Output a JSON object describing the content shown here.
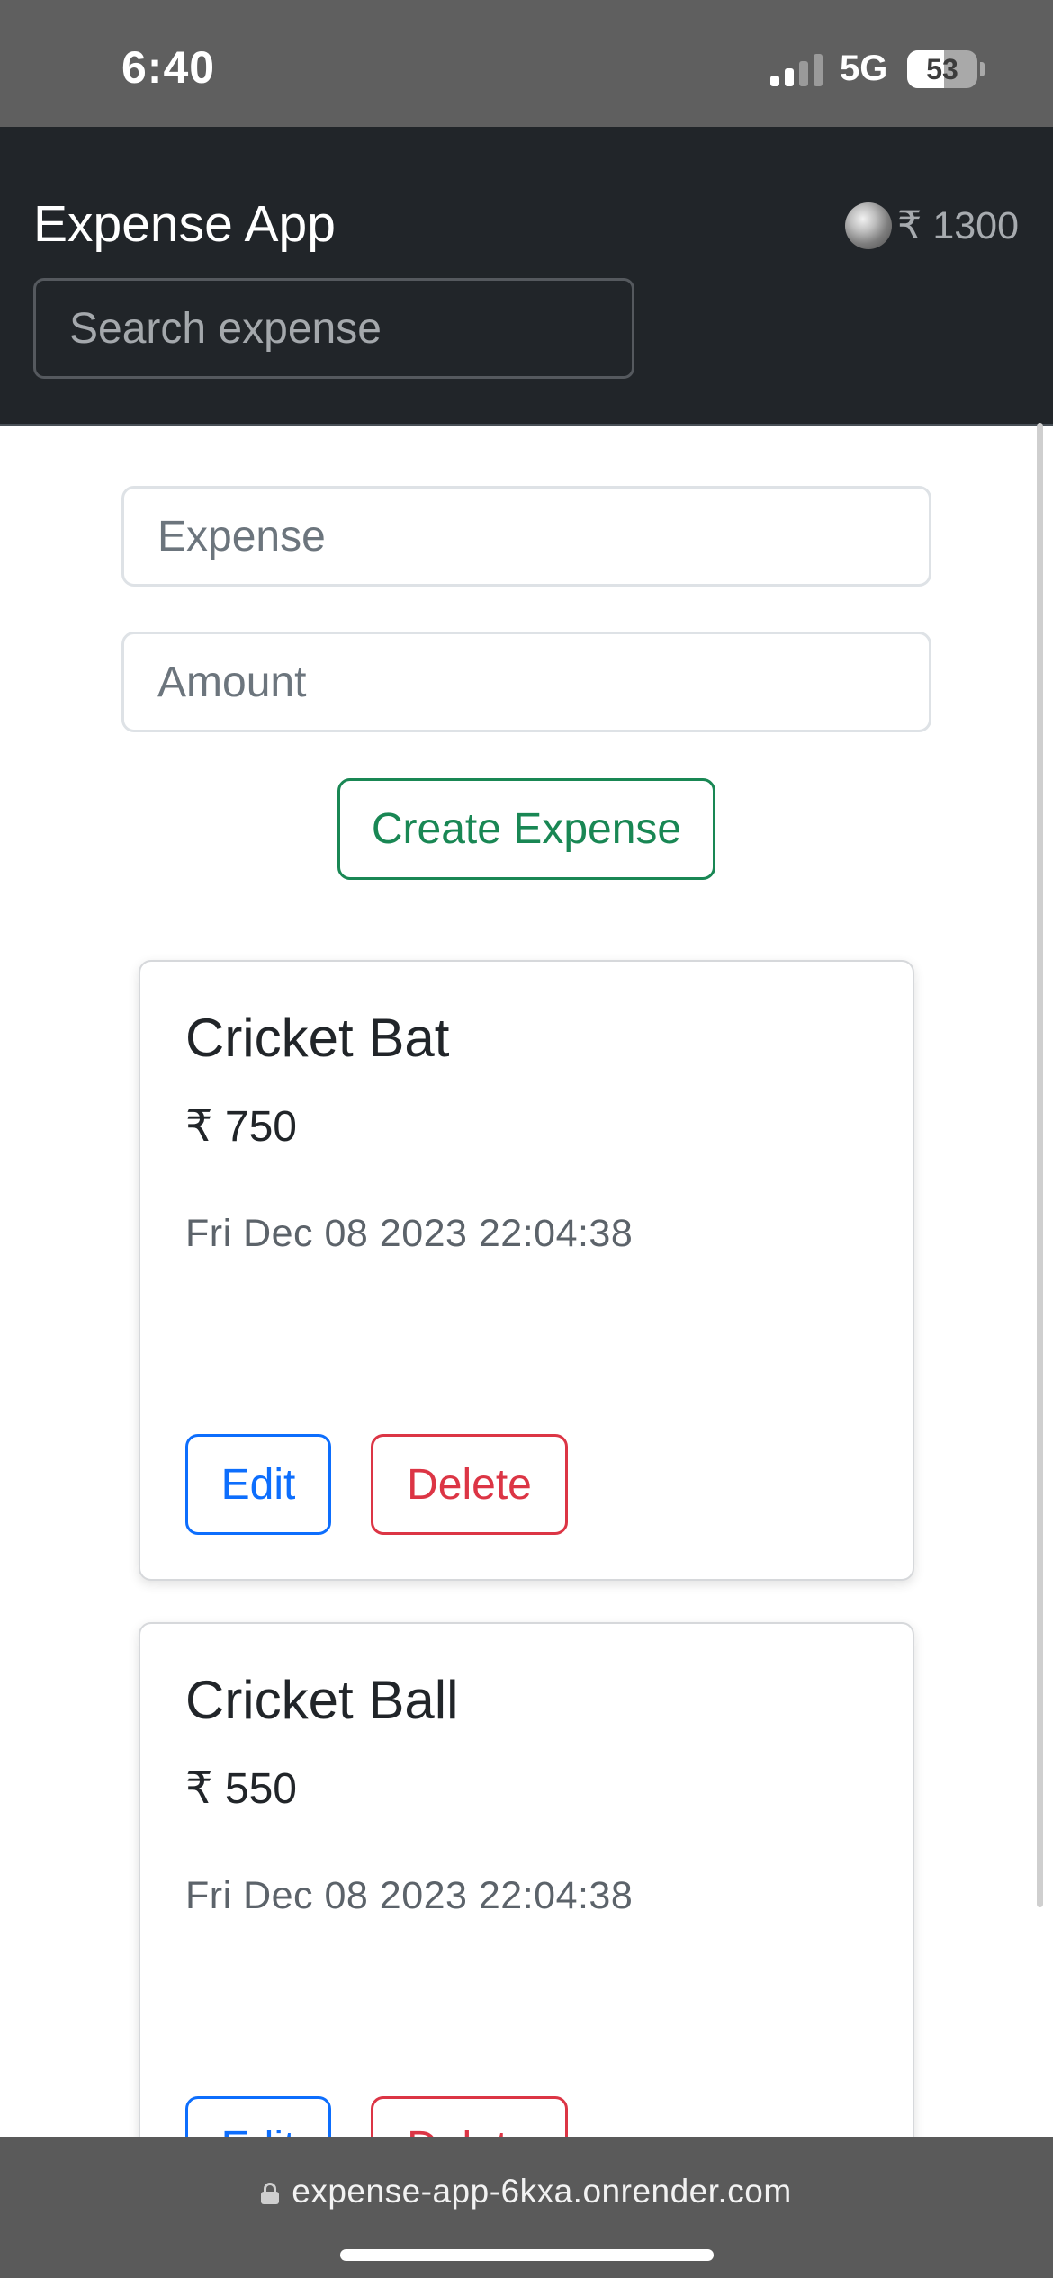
{
  "status_bar": {
    "time": "6:40",
    "network": "5G",
    "battery_percent": "53",
    "battery_level": 0.53,
    "signal_bars_active": 2,
    "signal_bars_total": 4
  },
  "navbar": {
    "brand": "Expense App",
    "search_placeholder": "Search expense",
    "balance": "₹ 1300",
    "coin_icon": "coin-icon",
    "background": "#212529"
  },
  "form": {
    "expense_placeholder": "Expense",
    "amount_placeholder": "Amount",
    "create_label": "Create Expense"
  },
  "expenses": [
    {
      "title": "Cricket Bat",
      "amount": "₹ 750",
      "date": "Fri Dec 08 2023 22:04:38",
      "edit_label": "Edit",
      "delete_label": "Delete"
    },
    {
      "title": "Cricket Ball",
      "amount": "₹ 550",
      "date": "Fri Dec 08 2023 22:04:38",
      "edit_label": "Edit",
      "delete_label": "Delete"
    }
  ],
  "browser": {
    "url": "expense-app-6kxa.onrender.com",
    "lock_icon": "lock-icon"
  },
  "colors": {
    "success": "#198754",
    "primary": "#0d6efd",
    "danger": "#dc3545"
  }
}
